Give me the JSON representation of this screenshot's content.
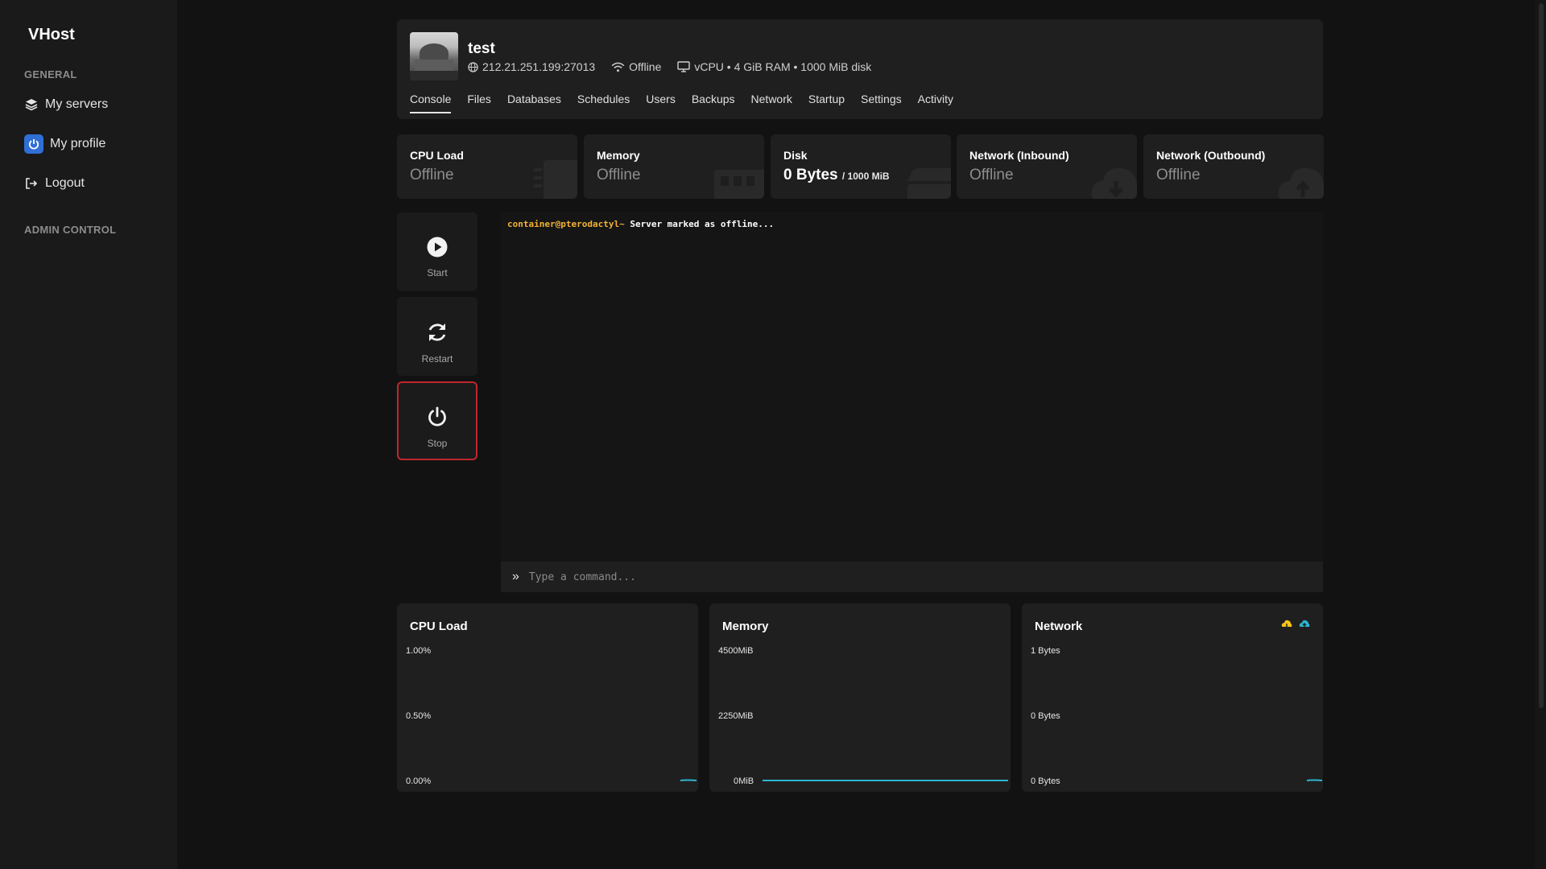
{
  "sidebar": {
    "brand": "VHost",
    "general_label": "GENERAL",
    "items": [
      {
        "label": "My servers",
        "icon": "layers-icon"
      },
      {
        "label": "My profile",
        "icon": "power-icon"
      },
      {
        "label": "Logout",
        "icon": "logout-icon"
      }
    ],
    "admin_label": "ADMIN CONTROL"
  },
  "server": {
    "name": "test",
    "address": "212.21.251.199:27013",
    "status": "Offline",
    "resources": "vCPU • 4 GiB RAM • 1000 MiB disk"
  },
  "tabs": [
    "Console",
    "Files",
    "Databases",
    "Schedules",
    "Users",
    "Backups",
    "Network",
    "Startup",
    "Settings",
    "Activity"
  ],
  "active_tab": "Console",
  "stats": [
    {
      "label": "CPU Load",
      "value": "Offline",
      "icon": "cpu-icon"
    },
    {
      "label": "Memory",
      "value": "Offline",
      "icon": "memory-icon"
    },
    {
      "label": "Disk",
      "value": "0 Bytes",
      "sub": "/ 1000 MiB",
      "icon": "disk-icon"
    },
    {
      "label": "Network (Inbound)",
      "value": "Offline",
      "icon": "cloud-download-icon"
    },
    {
      "label": "Network (Outbound)",
      "value": "Offline",
      "icon": "cloud-upload-icon"
    }
  ],
  "power": {
    "start": "Start",
    "restart": "Restart",
    "stop": "Stop"
  },
  "console": {
    "prompt": "container@pterodactyl~",
    "message": "Server marked as offline...",
    "placeholder": "Type a command..."
  },
  "graphs": {
    "cpu": {
      "title": "CPU Load",
      "ticks": [
        "1.00%",
        "0.50%",
        "0.00%"
      ]
    },
    "memory": {
      "title": "Memory",
      "ticks": [
        "4500MiB",
        "2250MiB",
        "0MiB"
      ]
    },
    "network": {
      "title": "Network",
      "ticks": [
        "1 Bytes",
        "0 Bytes",
        "0 Bytes"
      ]
    }
  },
  "colors": {
    "accent_line": "#2bb6d1",
    "stop_border": "#c0262d",
    "prompt": "#f2b233",
    "legend_inbound": "#f5c518",
    "legend_outbound": "#2bb6d1"
  }
}
